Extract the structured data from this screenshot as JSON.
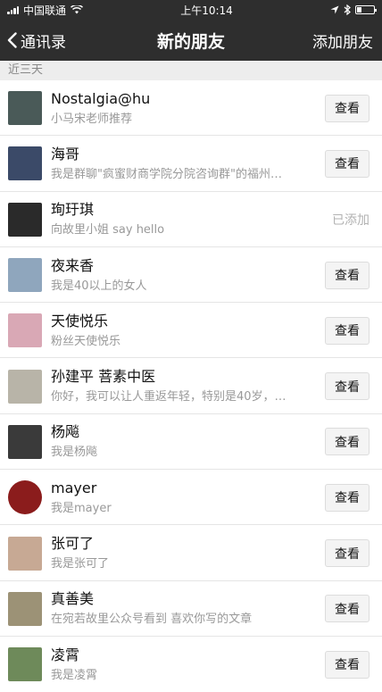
{
  "status_bar": {
    "carrier": "中国联通",
    "time": "上午10:14"
  },
  "nav": {
    "back_label": "通讯录",
    "title": "新的朋友",
    "action_label": "添加朋友"
  },
  "section_label": "近三天",
  "friends": [
    {
      "name": "Nostalgia@hu",
      "message": "小马宋老师推荐",
      "action": "查看",
      "status": "view",
      "avatar_color": "#4a5a58",
      "avatar_shape": "square"
    },
    {
      "name": "海哥",
      "message": "我是群聊\"疯蜜财商学院分院咨询群\"的福州…",
      "action": "查看",
      "status": "view",
      "avatar_color": "#3b4a68",
      "avatar_shape": "square"
    },
    {
      "name": "珣玗琪",
      "message": "向故里小姐 say hello",
      "action": "已添加",
      "status": "added",
      "avatar_color": "#2a2a2a",
      "avatar_shape": "square"
    },
    {
      "name": "夜来香",
      "message": "我是40以上的女人",
      "action": "查看",
      "status": "view",
      "avatar_color": "#8fa6bd",
      "avatar_shape": "square"
    },
    {
      "name": "天使悦乐",
      "message": "粉丝天使悦乐",
      "action": "查看",
      "status": "view",
      "avatar_color": "#d9a8b5",
      "avatar_shape": "square"
    },
    {
      "name": "孙建平 菩素中医",
      "message": "你好，我可以让人重返年轻，特别是40岁，…",
      "action": "查看",
      "status": "view",
      "avatar_color": "#b8b4a8",
      "avatar_shape": "square"
    },
    {
      "name": "杨飚",
      "message": "我是杨飚",
      "action": "查看",
      "status": "view",
      "avatar_color": "#3a3a3a",
      "avatar_shape": "square"
    },
    {
      "name": "mayer",
      "message": "我是mayer",
      "action": "查看",
      "status": "view",
      "avatar_color": "#8b1c1c",
      "avatar_shape": "round"
    },
    {
      "name": "张可了",
      "message": "我是张可了",
      "action": "查看",
      "status": "view",
      "avatar_color": "#c7a994",
      "avatar_shape": "square"
    },
    {
      "name": "真善美",
      "message": "在宛若故里公众号看到 喜欢你写的文章",
      "action": "查看",
      "status": "view",
      "avatar_color": "#9c9276",
      "avatar_shape": "square"
    },
    {
      "name": "凌霄",
      "message": "我是凌霄",
      "action": "查看",
      "status": "view",
      "avatar_color": "#6e8a5a",
      "avatar_shape": "square"
    }
  ]
}
